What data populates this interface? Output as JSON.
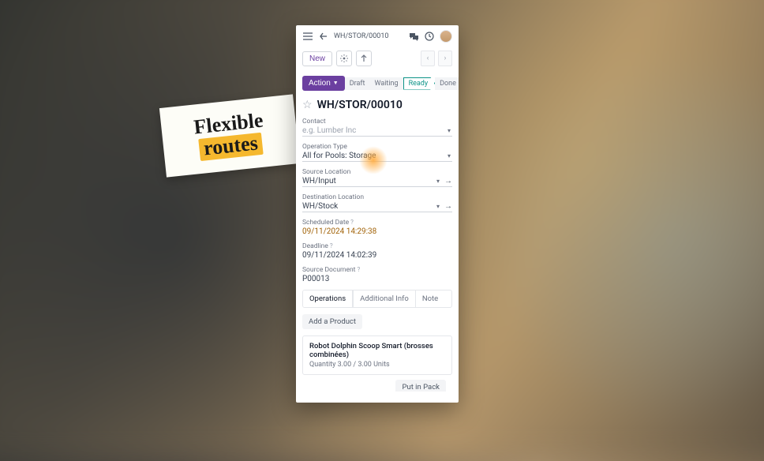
{
  "sticky": {
    "line1": "Flexible",
    "line2": "routes"
  },
  "topbar": {
    "breadcrumb": "WH/STOR/00010"
  },
  "toolbar": {
    "new_label": "New"
  },
  "status": {
    "action_label": "Action",
    "chips": {
      "draft": "Draft",
      "waiting": "Waiting",
      "ready": "Ready",
      "done": "Done"
    }
  },
  "title": "WH/STOR/00010",
  "fields": {
    "contact": {
      "label": "Contact",
      "placeholder": "e.g. Lumber Inc"
    },
    "operation_type": {
      "label": "Operation Type",
      "value": "All for Pools: Storage"
    },
    "source_location": {
      "label": "Source Location",
      "value": "WH/Input"
    },
    "destination_location": {
      "label": "Destination Location",
      "value": "WH/Stock"
    },
    "scheduled_date": {
      "label": "Scheduled Date",
      "value": "09/11/2024 14:29:38"
    },
    "deadline": {
      "label": "Deadline",
      "value": "09/11/2024 14:02:39"
    },
    "source_document": {
      "label": "Source Document",
      "value": "P00013"
    }
  },
  "tabs": {
    "operations": "Operations",
    "additional_info": "Additional Info",
    "note": "Note"
  },
  "add_product_label": "Add a Product",
  "product": {
    "name": "Robot Dolphin Scoop Smart (brosses combinées)",
    "qty": "Quantity 3.00 / 3.00 Units"
  },
  "footer": {
    "put_in_pack": "Put in Pack"
  }
}
